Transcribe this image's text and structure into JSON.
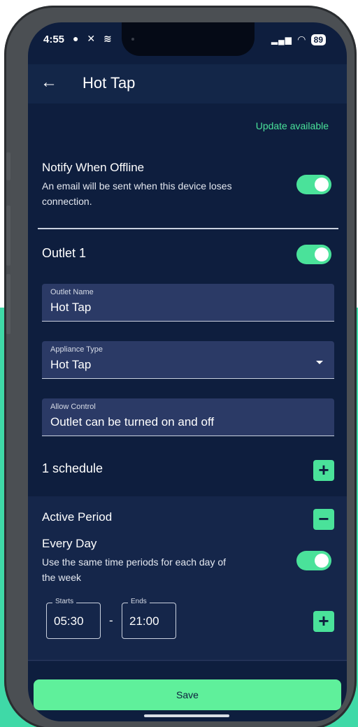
{
  "status_bar": {
    "time": "4:55",
    "icons": "● ✕ ≋",
    "battery": "89"
  },
  "app_bar": {
    "title": "Hot Tap"
  },
  "update_text": "Update available",
  "notify_offline": {
    "title": "Notify When Offline",
    "description_line1": "An email will be sent when this device loses",
    "description_line2": "connection.",
    "enabled": true
  },
  "outlet": {
    "title": "Outlet 1",
    "enabled": true
  },
  "fields": {
    "outlet_name": {
      "label": "Outlet Name",
      "value": "Hot Tap"
    },
    "appliance_type": {
      "label": "Appliance Type",
      "value": "Hot Tap"
    },
    "allow_control": {
      "label": "Allow Control",
      "value": "Outlet can be turned on and off"
    }
  },
  "schedule": {
    "count_label": "1 schedule",
    "active_period": "Active Period",
    "every_day": "Every Day",
    "every_day_desc_line1": "Use the same time periods for each day of",
    "every_day_desc_line2": "the week",
    "every_day_enabled": true,
    "starts_label": "Starts",
    "starts_value": "05:30",
    "separator": "-",
    "ends_label": "Ends",
    "ends_value": "21:00"
  },
  "buttons": {
    "save": "Save",
    "plus": "+",
    "minus": "−"
  },
  "colors": {
    "background": "#0e1e3e",
    "accent": "#4ae29a",
    "field": "#2b3a66"
  }
}
